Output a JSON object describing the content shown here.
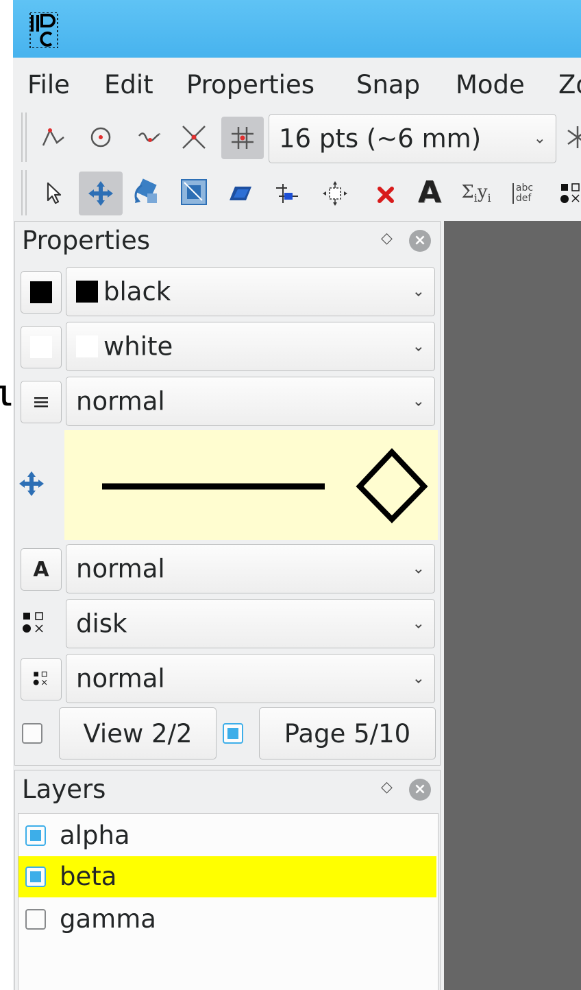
{
  "menu": [
    "File",
    "Edit",
    "Properties",
    "Snap",
    "Mode",
    "Zo"
  ],
  "toolbar": {
    "grid_size": "16 pts (~6 mm)",
    "snap_icons": [
      "snap-vertex-icon",
      "snap-center-icon",
      "snap-boundary-icon",
      "snap-intersection-icon",
      "snap-grid-icon"
    ],
    "mode_icons": [
      "select-icon",
      "translate-icon",
      "rotate-icon",
      "stretch-icon",
      "shear-icon",
      "graph-icon",
      "pan-icon",
      "delete-icon",
      "text-icon",
      "math-icon",
      "paragraph-icon",
      "mark-icon"
    ]
  },
  "properties": {
    "title": "Properties",
    "stroke": "black",
    "fill": "white",
    "pen": "normal",
    "text_size": "normal",
    "mark_shape": "disk",
    "symbol_size": "normal",
    "view_label": "View 2/2",
    "page_label": "Page 5/10",
    "colors": {
      "stroke": "#000000",
      "fill": "#ffffff",
      "preview_bg": "#fffdd0"
    }
  },
  "layers": {
    "title": "Layers",
    "items": [
      {
        "name": "alpha",
        "checked": true,
        "selected": false
      },
      {
        "name": "beta",
        "checked": true,
        "selected": true
      },
      {
        "name": "gamma",
        "checked": false,
        "selected": false
      }
    ],
    "highlight_color": "#ffff00"
  },
  "canvas_color": "#666666",
  "stray_text": "l"
}
